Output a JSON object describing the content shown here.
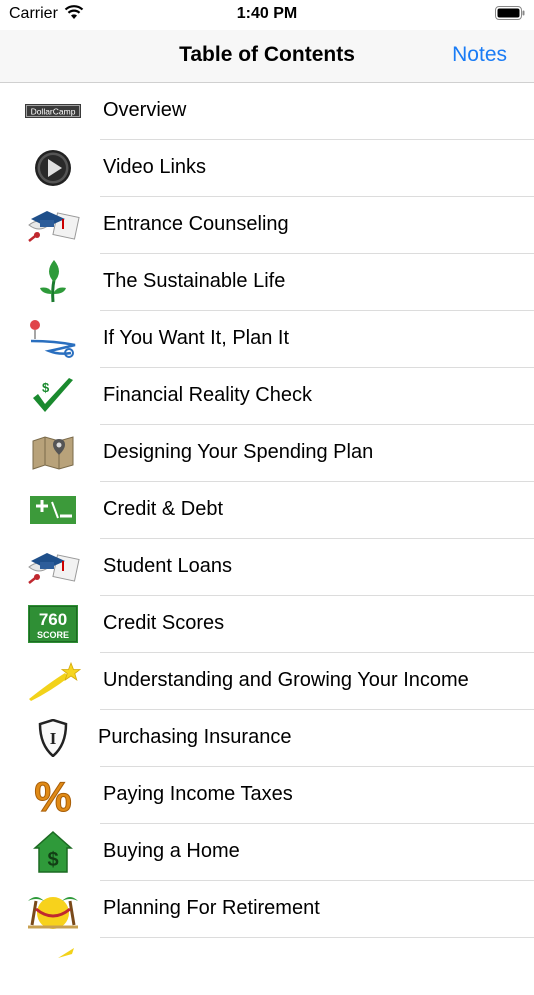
{
  "status": {
    "carrier": "Carrier",
    "time": "1:40 PM"
  },
  "nav": {
    "title": "Table of Contents",
    "notes_label": "Notes"
  },
  "items": [
    {
      "label": "Overview",
      "icon": "dollarcamp-logo-icon",
      "icon_text": "DollarCamp"
    },
    {
      "label": "Video Links",
      "icon": "play-button-icon"
    },
    {
      "label": "Entrance Counseling",
      "icon": "graduation-cap-diploma-icon"
    },
    {
      "label": "The Sustainable Life",
      "icon": "sprout-icon"
    },
    {
      "label": "If You Want It, Plan It",
      "icon": "map-route-pin-icon"
    },
    {
      "label": "Financial Reality Check",
      "icon": "dollar-checkmark-icon"
    },
    {
      "label": "Designing Your Spending Plan",
      "icon": "folded-map-icon"
    },
    {
      "label": "Credit & Debt",
      "icon": "plus-minus-icon",
      "icon_text": "+/−"
    },
    {
      "label": "Student Loans",
      "icon": "graduation-cap-diploma-icon"
    },
    {
      "label": "Credit Scores",
      "icon": "credit-score-badge-icon",
      "icon_text": "760",
      "icon_subtext": "SCORE"
    },
    {
      "label": "Understanding and Growing Your Income",
      "icon": "shooting-star-icon"
    },
    {
      "label": "Purchasing Insurance",
      "icon": "shield-icon",
      "icon_text": "I"
    },
    {
      "label": "Paying Income Taxes",
      "icon": "percent-icon",
      "icon_text": "%"
    },
    {
      "label": "Buying a Home",
      "icon": "house-dollar-icon",
      "icon_text": "$"
    },
    {
      "label": "Planning For Retirement",
      "icon": "hammock-palm-icon"
    }
  ],
  "colors": {
    "accent": "#1a7cf5"
  }
}
